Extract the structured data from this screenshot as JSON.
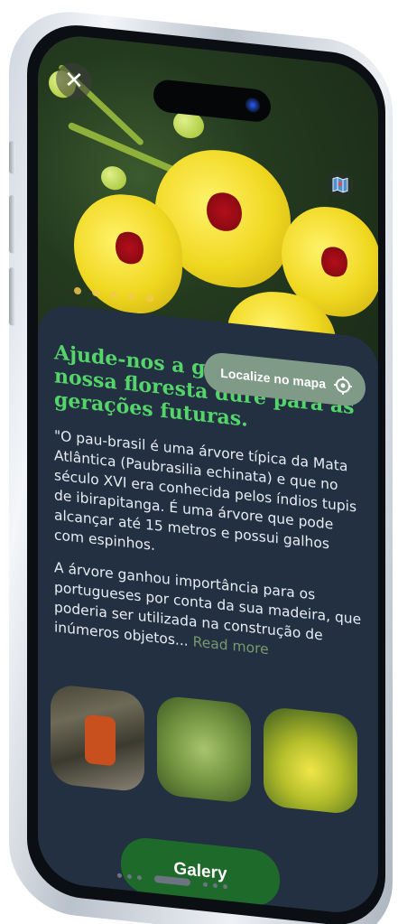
{
  "hero": {
    "close_icon": "close-icon",
    "map_icon": "map-icon",
    "carousel_count": 5
  },
  "locate_button": {
    "label": "Localize no mapa",
    "icon": "location-target-icon"
  },
  "article": {
    "headline": "Ajude-nos a garantir que nossa floresta dure para as gerações futuras.",
    "paragraph1": "\"O pau-brasil é uma árvore típica da Mata Atlântica (Paubrasilia echinata) e que no século XVI era conhecida pelos índios tupis de ibirapitanga. É uma árvore que pode alcançar até 15 metros e possui galhos com espinhos.",
    "paragraph2": "A árvore ganhou importância para os portugueses por conta da sua madeira, que poderia ser utilizada na construção de inúmeros objetos...",
    "read_more": "Read more"
  },
  "gallery": {
    "button_label": "Galery",
    "thumbnails": [
      "tree-bark-photo",
      "leaves-photo",
      "yellow-flowers-photo"
    ]
  },
  "colors": {
    "card_bg": "#223041",
    "headline": "#55d46a",
    "locate_button": "#7f9a86",
    "galery_button": "#1e6a2a",
    "read_more": "#7a9a6e"
  }
}
